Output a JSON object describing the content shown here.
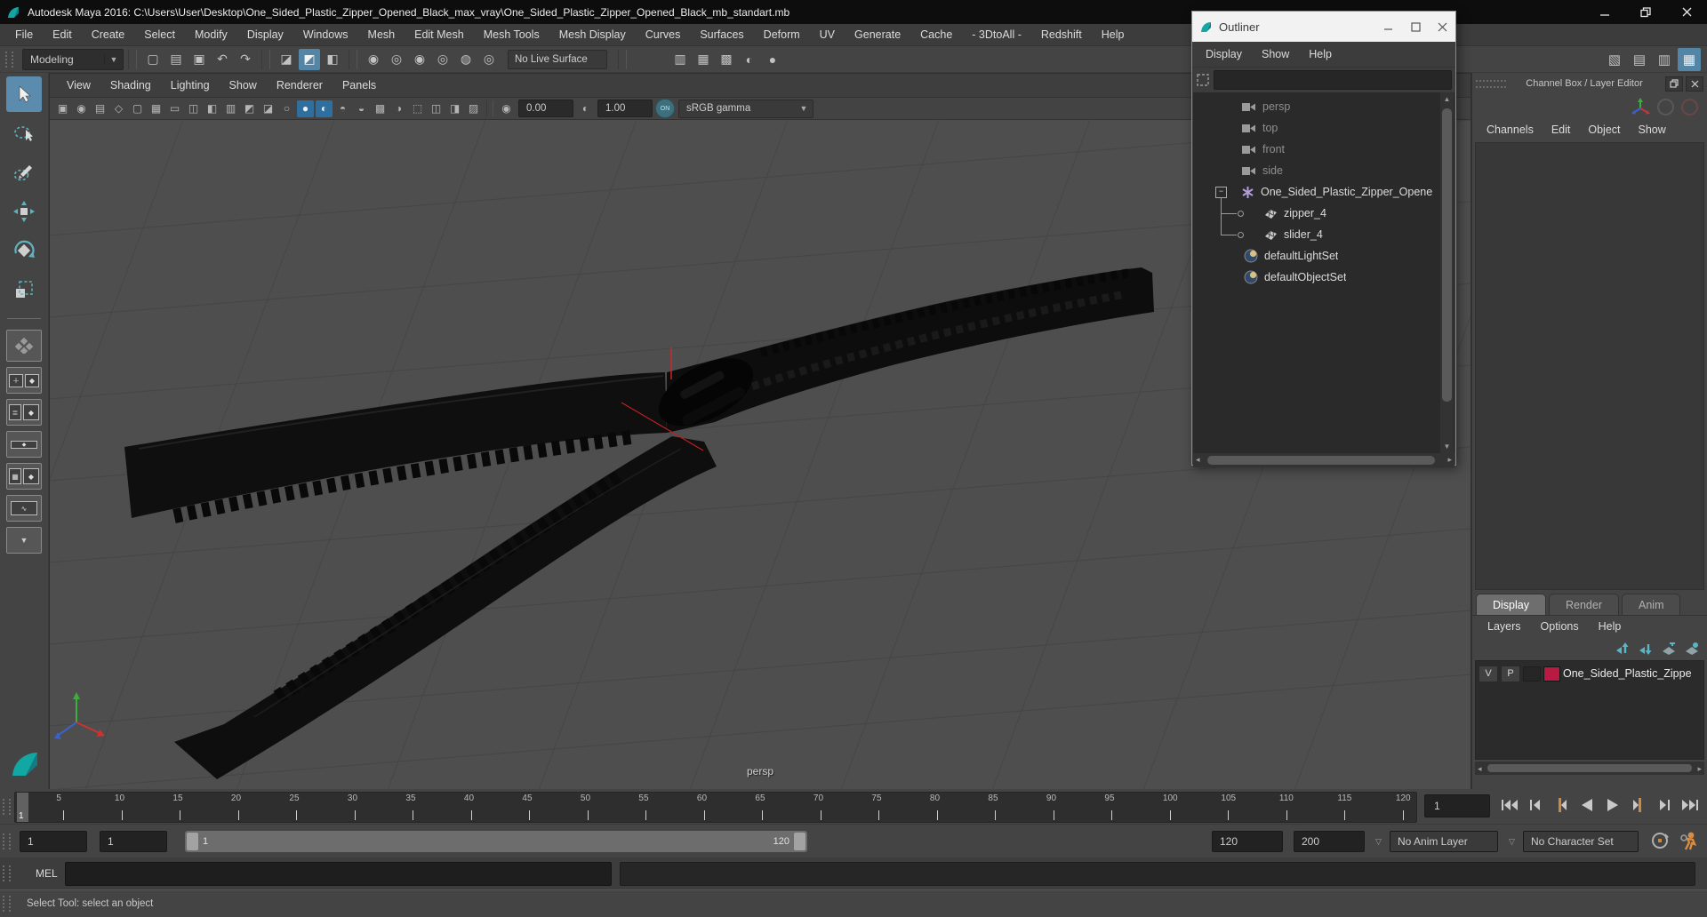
{
  "colors": {
    "active_blue": "#5285a6",
    "icon_teal": "#4db6c2",
    "marker_orange": "#c98743",
    "layer_swatch": "#b81b42",
    "maya_teal": "#12a7a3"
  },
  "window": {
    "title": "Autodesk Maya 2016: C:\\Users\\User\\Desktop\\One_Sided_Plastic_Zipper_Opened_Black_max_vray\\One_Sided_Plastic_Zipper_Opened_Black_mb_standart.mb"
  },
  "menubar": {
    "items": [
      "File",
      "Edit",
      "Create",
      "Select",
      "Modify",
      "Display",
      "Windows",
      "Mesh",
      "Edit Mesh",
      "Mesh Tools",
      "Mesh Display",
      "Curves",
      "Surfaces",
      "Deform",
      "UV",
      "Generate",
      "Cache",
      "- 3DtoAll -",
      "Redshift",
      "Help"
    ]
  },
  "statusline": {
    "menuset": "Modeling",
    "live_surface": "No Live Surface",
    "file_icons": [
      {
        "n": "new-scene-icon",
        "g": "▢"
      },
      {
        "n": "open-scene-icon",
        "g": "▤"
      },
      {
        "n": "save-scene-icon",
        "g": "▣"
      },
      {
        "n": "undo-icon",
        "g": "↶"
      },
      {
        "n": "redo-icon",
        "g": "↷"
      }
    ],
    "mode_icons": [
      {
        "n": "select-hierarchy-icon",
        "g": "◪"
      },
      {
        "n": "select-object-icon",
        "g": "◩",
        "a": 1
      },
      {
        "n": "select-component-icon",
        "g": "◧"
      }
    ],
    "snap_icons": [
      {
        "n": "snap-grid-icon",
        "g": "◉"
      },
      {
        "n": "snap-curve-icon",
        "g": "◎"
      },
      {
        "n": "snap-point-icon",
        "g": "◉"
      },
      {
        "n": "snap-plane-icon",
        "g": "◎"
      },
      {
        "n": "make-live-icon",
        "g": "◍"
      },
      {
        "n": "snap-view-icon",
        "g": "◎"
      }
    ],
    "render_icons": [
      {
        "n": "render-view-icon",
        "g": "▥"
      },
      {
        "n": "render-frame-icon",
        "g": "▦"
      },
      {
        "n": "ipr-render-icon",
        "g": "▩"
      },
      {
        "n": "render-settings-icon",
        "g": "◐"
      },
      {
        "n": "hypershade-icon",
        "g": "●"
      }
    ],
    "sidebar_icons": [
      {
        "n": "modeling-toolkit-icon",
        "g": "▧"
      },
      {
        "n": "attribute-editor-icon",
        "g": "▤"
      },
      {
        "n": "tool-settings-icon",
        "g": "▥"
      },
      {
        "n": "channel-box-toggle-icon",
        "g": "▦",
        "a": 1
      }
    ]
  },
  "panel_menu": {
    "items": [
      "View",
      "Shading",
      "Lighting",
      "Show",
      "Renderer",
      "Panels"
    ]
  },
  "viewport_bar": {
    "icons": [
      {
        "n": "select-camera-icon",
        "g": "▣"
      },
      {
        "n": "lock-camera-icon",
        "g": "◉"
      },
      {
        "n": "camera-attributes-icon",
        "g": "▤"
      },
      {
        "n": "bookmark-icon",
        "g": "◇"
      },
      {
        "n": "image-plane-icon",
        "g": "▢"
      },
      {
        "n": "grid-icon",
        "g": "▦"
      },
      {
        "n": "film-gate-icon",
        "g": "▭"
      },
      {
        "n": "resolution-gate-icon",
        "g": "◫"
      },
      {
        "n": "gate-mask-icon",
        "g": "◧"
      },
      {
        "n": "field-chart-icon",
        "g": "▥"
      },
      {
        "n": "safe-action-icon",
        "g": "◩"
      },
      {
        "n": "safe-title-icon",
        "g": "◪"
      },
      {
        "n": "wireframe-icon",
        "g": "○"
      },
      {
        "n": "smooth-shade-icon",
        "g": "●",
        "a": 1
      },
      {
        "n": "textured-icon",
        "g": "◐",
        "a": 1
      },
      {
        "n": "lights-icon",
        "g": "◓"
      },
      {
        "n": "shadows-icon",
        "g": "◒"
      },
      {
        "n": "occlusion-icon",
        "g": "▩"
      },
      {
        "n": "motion-blur-icon",
        "g": "◑"
      },
      {
        "n": "isolate-select-icon",
        "g": "⬚"
      },
      {
        "n": "pane-copy-icon",
        "g": "◫"
      },
      {
        "n": "pane-paste-icon",
        "g": "◨"
      },
      {
        "n": "snapshot-icon",
        "g": "▨"
      }
    ],
    "exposure": "0.00",
    "gamma": "1.00",
    "on_label": "ON",
    "view_transform": "sRGB gamma"
  },
  "viewport": {
    "camera_label": "persp"
  },
  "outliner": {
    "title": "Outliner",
    "menus": [
      "Display",
      "Show",
      "Help"
    ],
    "items": [
      {
        "label": "persp"
      },
      {
        "label": "top"
      },
      {
        "label": "front"
      },
      {
        "label": "side"
      },
      {
        "label": "One_Sided_Plastic_Zipper_Opene"
      },
      {
        "label": "zipper_4"
      },
      {
        "label": "slider_4"
      },
      {
        "label": "defaultLightSet"
      },
      {
        "label": "defaultObjectSet"
      }
    ]
  },
  "channel_box": {
    "header": "Channel Box / Layer Editor",
    "menus": [
      "Channels",
      "Edit",
      "Object",
      "Show"
    ]
  },
  "layer_editor": {
    "tabs": [
      {
        "t": "Display",
        "a": 1
      },
      {
        "t": "Render"
      },
      {
        "t": "Anim"
      }
    ],
    "menus": [
      "Layers",
      "Options",
      "Help"
    ],
    "layer": {
      "visibility": "V",
      "playback": "P",
      "name": "One_Sided_Plastic_Zippe"
    }
  },
  "timeline": {
    "current_frame": "1",
    "ticks": [
      5,
      10,
      15,
      20,
      25,
      30,
      35,
      40,
      45,
      50,
      55,
      60,
      65,
      70,
      75,
      80,
      85,
      90,
      95,
      100,
      105,
      110,
      115,
      120
    ],
    "current_field": "1"
  },
  "range_slider": {
    "anim_start": "1",
    "playback_start": "1",
    "bar_start": "1",
    "bar_end": "120",
    "playback_end": "120",
    "anim_end": "200",
    "anim_layer": "No Anim Layer",
    "character_set": "No Character Set"
  },
  "command_line": {
    "label": "MEL"
  },
  "help_line": {
    "text": "Select Tool: select an object"
  }
}
